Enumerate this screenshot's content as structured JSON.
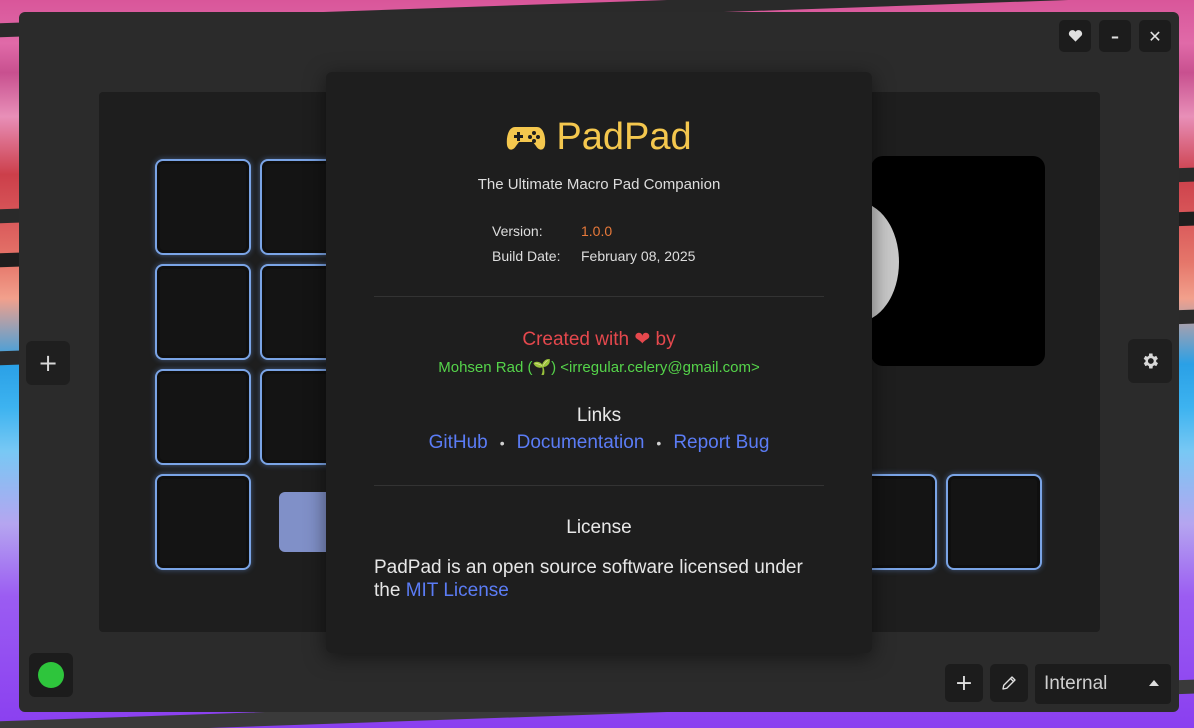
{
  "window_controls": {
    "favorite_icon": "heart-icon",
    "minimize_label": "–",
    "close_label": "✕"
  },
  "toolbar": {
    "add_label": "+",
    "settings_icon": "gear-icon",
    "bottom_add_label": "+",
    "edit_icon": "pencil-icon",
    "profile_select_value": "Internal"
  },
  "about": {
    "icon": "gamepad-icon",
    "app_name": "PadPad",
    "tagline": "The Ultimate Macro Pad Companion",
    "version_label": "Version:",
    "version_value": "1.0.0",
    "build_label": "Build Date:",
    "build_value": "February 08, 2025",
    "created_prefix": "Created with",
    "created_suffix": "by",
    "author": "Mohsen Rad (🌱) <irregular.celery@gmail.com>",
    "links_heading": "Links",
    "links": [
      {
        "label": "GitHub"
      },
      {
        "label": "Documentation"
      },
      {
        "label": "Report Bug"
      }
    ],
    "license_heading": "License",
    "license_text_prefix": "PadPad is an open source software licensed under the",
    "license_link": "MIT License"
  },
  "colors": {
    "accent_title": "#f4c74e",
    "version": "#e8793a",
    "created": "#e5484d",
    "author": "#55d44a",
    "link": "#5b7cf5",
    "key_border": "#7aa4e6",
    "status_connected": "#2ec53c"
  }
}
